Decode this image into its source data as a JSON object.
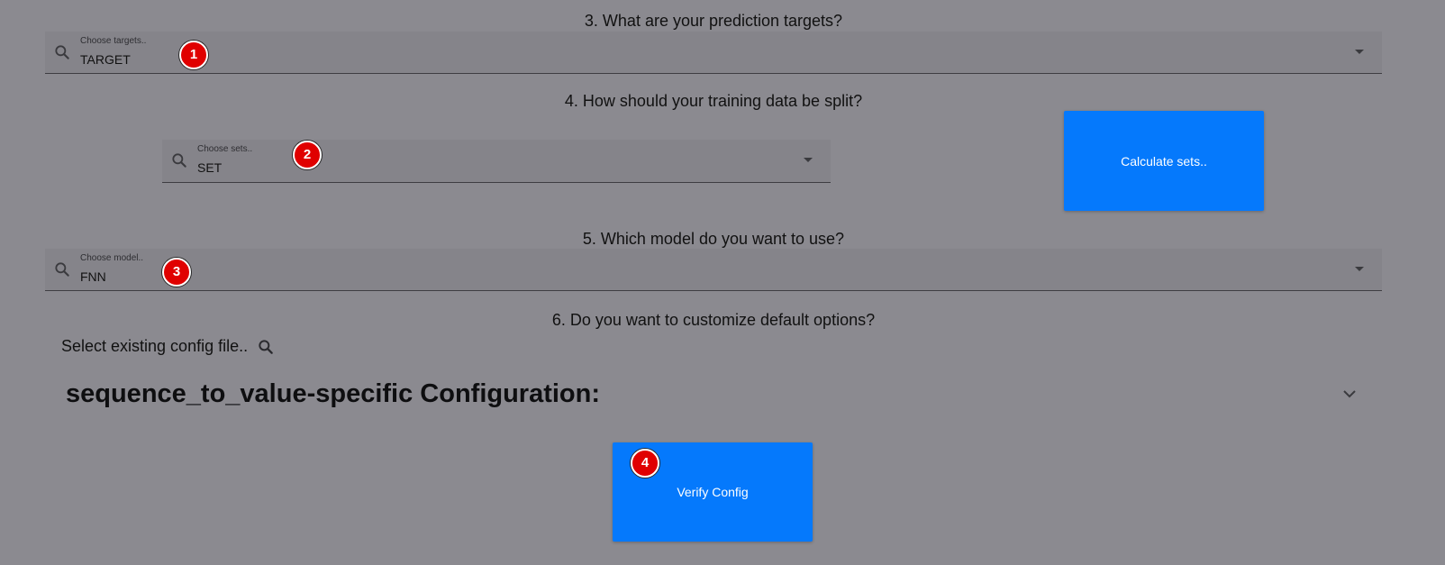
{
  "questions": {
    "q3": "3. What are your prediction targets?",
    "q4": "4. How should your training data be split?",
    "q5": "5. Which model do you want to use?",
    "q6": "6. Do you want to customize default options?"
  },
  "targets_select": {
    "label": "Choose targets..",
    "value": "TARGET",
    "badge": "1"
  },
  "sets_select": {
    "label": "Choose sets..",
    "value": "SET",
    "badge": "2"
  },
  "model_select": {
    "label": "Choose model..",
    "value": "FNN",
    "badge": "3"
  },
  "calculate_button": {
    "label": "Calculate sets.."
  },
  "config_file": {
    "label": "Select existing config file.."
  },
  "config_section": {
    "title": "sequence_to_value-specific Configuration:"
  },
  "verify_button": {
    "label": "Verify Config",
    "badge": "4"
  },
  "colors": {
    "background": "#8b8a90",
    "button_blue": "#0579fc",
    "badge_red": "#e00000"
  },
  "icons": {
    "search": "search-icon",
    "caret": "caret-down-icon",
    "chevron": "chevron-down-icon"
  }
}
